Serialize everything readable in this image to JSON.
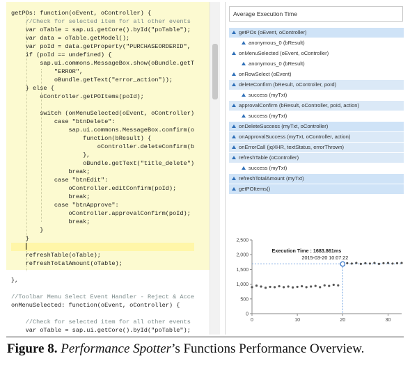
{
  "editor": {
    "lines": [
      {
        "t": "getPOs: function(oEvent, oController) {"
      },
      {
        "t": "    //Check for selected item for all other events",
        "c": "cmt"
      },
      {
        "t": "    var oTable = sap.ui.getCore().byId(\"poTable\");"
      },
      {
        "t": "    var data = oTable.getModel();"
      },
      {
        "t": "    var poId = data.getProperty(\"PURCHASEORDERID\","
      },
      {
        "t": "    if (poId == undefined) {"
      },
      {
        "t": "        sap.ui.commons.MessageBox.show(oBundle.getT"
      },
      {
        "t": "            \"ERROR\","
      },
      {
        "t": "            oBundle.getText(\"error_action\"));"
      },
      {
        "t": "    } else {"
      },
      {
        "t": "        oController.getPOItems(poId);"
      },
      {
        "t": ""
      },
      {
        "t": "        switch (onMenuSelected(oEvent, oController)"
      },
      {
        "t": "            case \"btnDelete\":"
      },
      {
        "t": "                sap.ui.commons.MessageBox.confirm(o"
      },
      {
        "t": "                    function(bResult) {"
      },
      {
        "t": "                        oController.deleteConfirm(b"
      },
      {
        "t": "                    },"
      },
      {
        "t": "                    oBundle.getText(\"title_delete\")"
      },
      {
        "t": "                break;"
      },
      {
        "t": "            case \"btnEdit\":"
      },
      {
        "t": "                oController.editConfirm(poId);"
      },
      {
        "t": "                break;"
      },
      {
        "t": "            case \"btnApprove\":"
      },
      {
        "t": "                oController.approvalConfirm(poId);"
      },
      {
        "t": "                break;"
      },
      {
        "t": "        }"
      },
      {
        "t": "    }"
      },
      {
        "t": "    ",
        "cursor": true
      },
      {
        "t": "    refreshTable(oTable);"
      },
      {
        "t": "    refreshTotalAmount(oTable);"
      },
      {
        "t": ""
      },
      {
        "t": "},"
      },
      {
        "t": ""
      },
      {
        "t": "//Toolbar Menu Select Event Handler - Reject & Acce",
        "c": "cmt"
      },
      {
        "t": "onMenuSelected: function(oEvent, oController) {"
      },
      {
        "t": ""
      },
      {
        "t": "    //Check for selected item for all other events",
        "c": "cmt"
      },
      {
        "t": "    var oTable = sap.ui.getCore().byId(\"poTable\");"
      }
    ]
  },
  "panel": {
    "dropdown_value": "Average Execution Time",
    "tree": [
      {
        "label": "getPOs (oEvent, oController)",
        "indent": 0,
        "state": "sel"
      },
      {
        "label": "anonymous_0 (bResult)",
        "indent": 1,
        "state": ""
      },
      {
        "label": "onMenuSelected (oEvent, oController)",
        "indent": 0,
        "state": ""
      },
      {
        "label": "anonymous_0 (bResult)",
        "indent": 1,
        "state": ""
      },
      {
        "label": "onRowSelect (oEvent)",
        "indent": 0,
        "state": ""
      },
      {
        "label": "deleteConfirm (bResult, oController, poId)",
        "indent": 0,
        "state": "sel2"
      },
      {
        "label": "success (myTxt)",
        "indent": 1,
        "state": ""
      },
      {
        "label": "approvalConfirm (bResult, oController, poId, action)",
        "indent": 0,
        "state": "sel2"
      },
      {
        "label": "success (myTxt)",
        "indent": 1,
        "state": ""
      },
      {
        "label": "onDeleteSuccess (myTxt, oController)",
        "indent": 0,
        "state": "sel"
      },
      {
        "label": "onApprovalSuccess (myTxt, oController, action)",
        "indent": 0,
        "state": "sel2"
      },
      {
        "label": "onErrorCall (jqXHR, textStatus, errorThrown)",
        "indent": 0,
        "state": "sel2"
      },
      {
        "label": "refreshTable (oController)",
        "indent": 0,
        "state": "sel2"
      },
      {
        "label": "success (myTxt)",
        "indent": 1,
        "state": ""
      },
      {
        "label": "refreshTotalAmount (myTxt)",
        "indent": 0,
        "state": "sel"
      },
      {
        "label": "getPOItems()",
        "indent": 0,
        "state": "sel"
      }
    ]
  },
  "chart_data": {
    "type": "scatter",
    "title": "",
    "xlabel": "",
    "ylabel": "",
    "xlim": [
      0,
      33
    ],
    "ylim": [
      0,
      2500
    ],
    "xticks": [
      0,
      10,
      20,
      30
    ],
    "yticks": [
      0,
      500,
      1000,
      1500,
      2000,
      2500
    ],
    "ytick_labels": [
      "0",
      "500",
      "1,000",
      "1,500",
      "2,000",
      "2,500"
    ],
    "points": [
      [
        0,
        900
      ],
      [
        1,
        950
      ],
      [
        2,
        920
      ],
      [
        3,
        880
      ],
      [
        4,
        910
      ],
      [
        5,
        900
      ],
      [
        6,
        930
      ],
      [
        7,
        900
      ],
      [
        8,
        920
      ],
      [
        9,
        890
      ],
      [
        10,
        910
      ],
      [
        11,
        930
      ],
      [
        12,
        900
      ],
      [
        13,
        920
      ],
      [
        14,
        940
      ],
      [
        15,
        900
      ],
      [
        16,
        960
      ],
      [
        17,
        940
      ],
      [
        18,
        980
      ],
      [
        19,
        960
      ],
      [
        20,
        1690
      ],
      [
        21,
        1710
      ],
      [
        22,
        1700
      ],
      [
        23,
        1720
      ],
      [
        24,
        1690
      ],
      [
        25,
        1710
      ],
      [
        26,
        1700
      ],
      [
        27,
        1720
      ],
      [
        28,
        1690
      ],
      [
        29,
        1710
      ],
      [
        30,
        1720
      ],
      [
        31,
        1700
      ],
      [
        32,
        1710
      ],
      [
        33,
        1720
      ]
    ],
    "highlight": {
      "x": 20,
      "y": 1683.861
    },
    "tooltip": {
      "label": "Execution Time : 1683.861ms",
      "date": "2015-03-20 10:07:22"
    },
    "colors": {
      "points": "#555555",
      "highlight": "#3a78c9",
      "guide": "#4a88d8",
      "axis": "#888888"
    }
  },
  "caption": {
    "label": "Figure 8.",
    "tool": "Performance Spotter",
    "rest": "’s Functions Performance Overview."
  }
}
